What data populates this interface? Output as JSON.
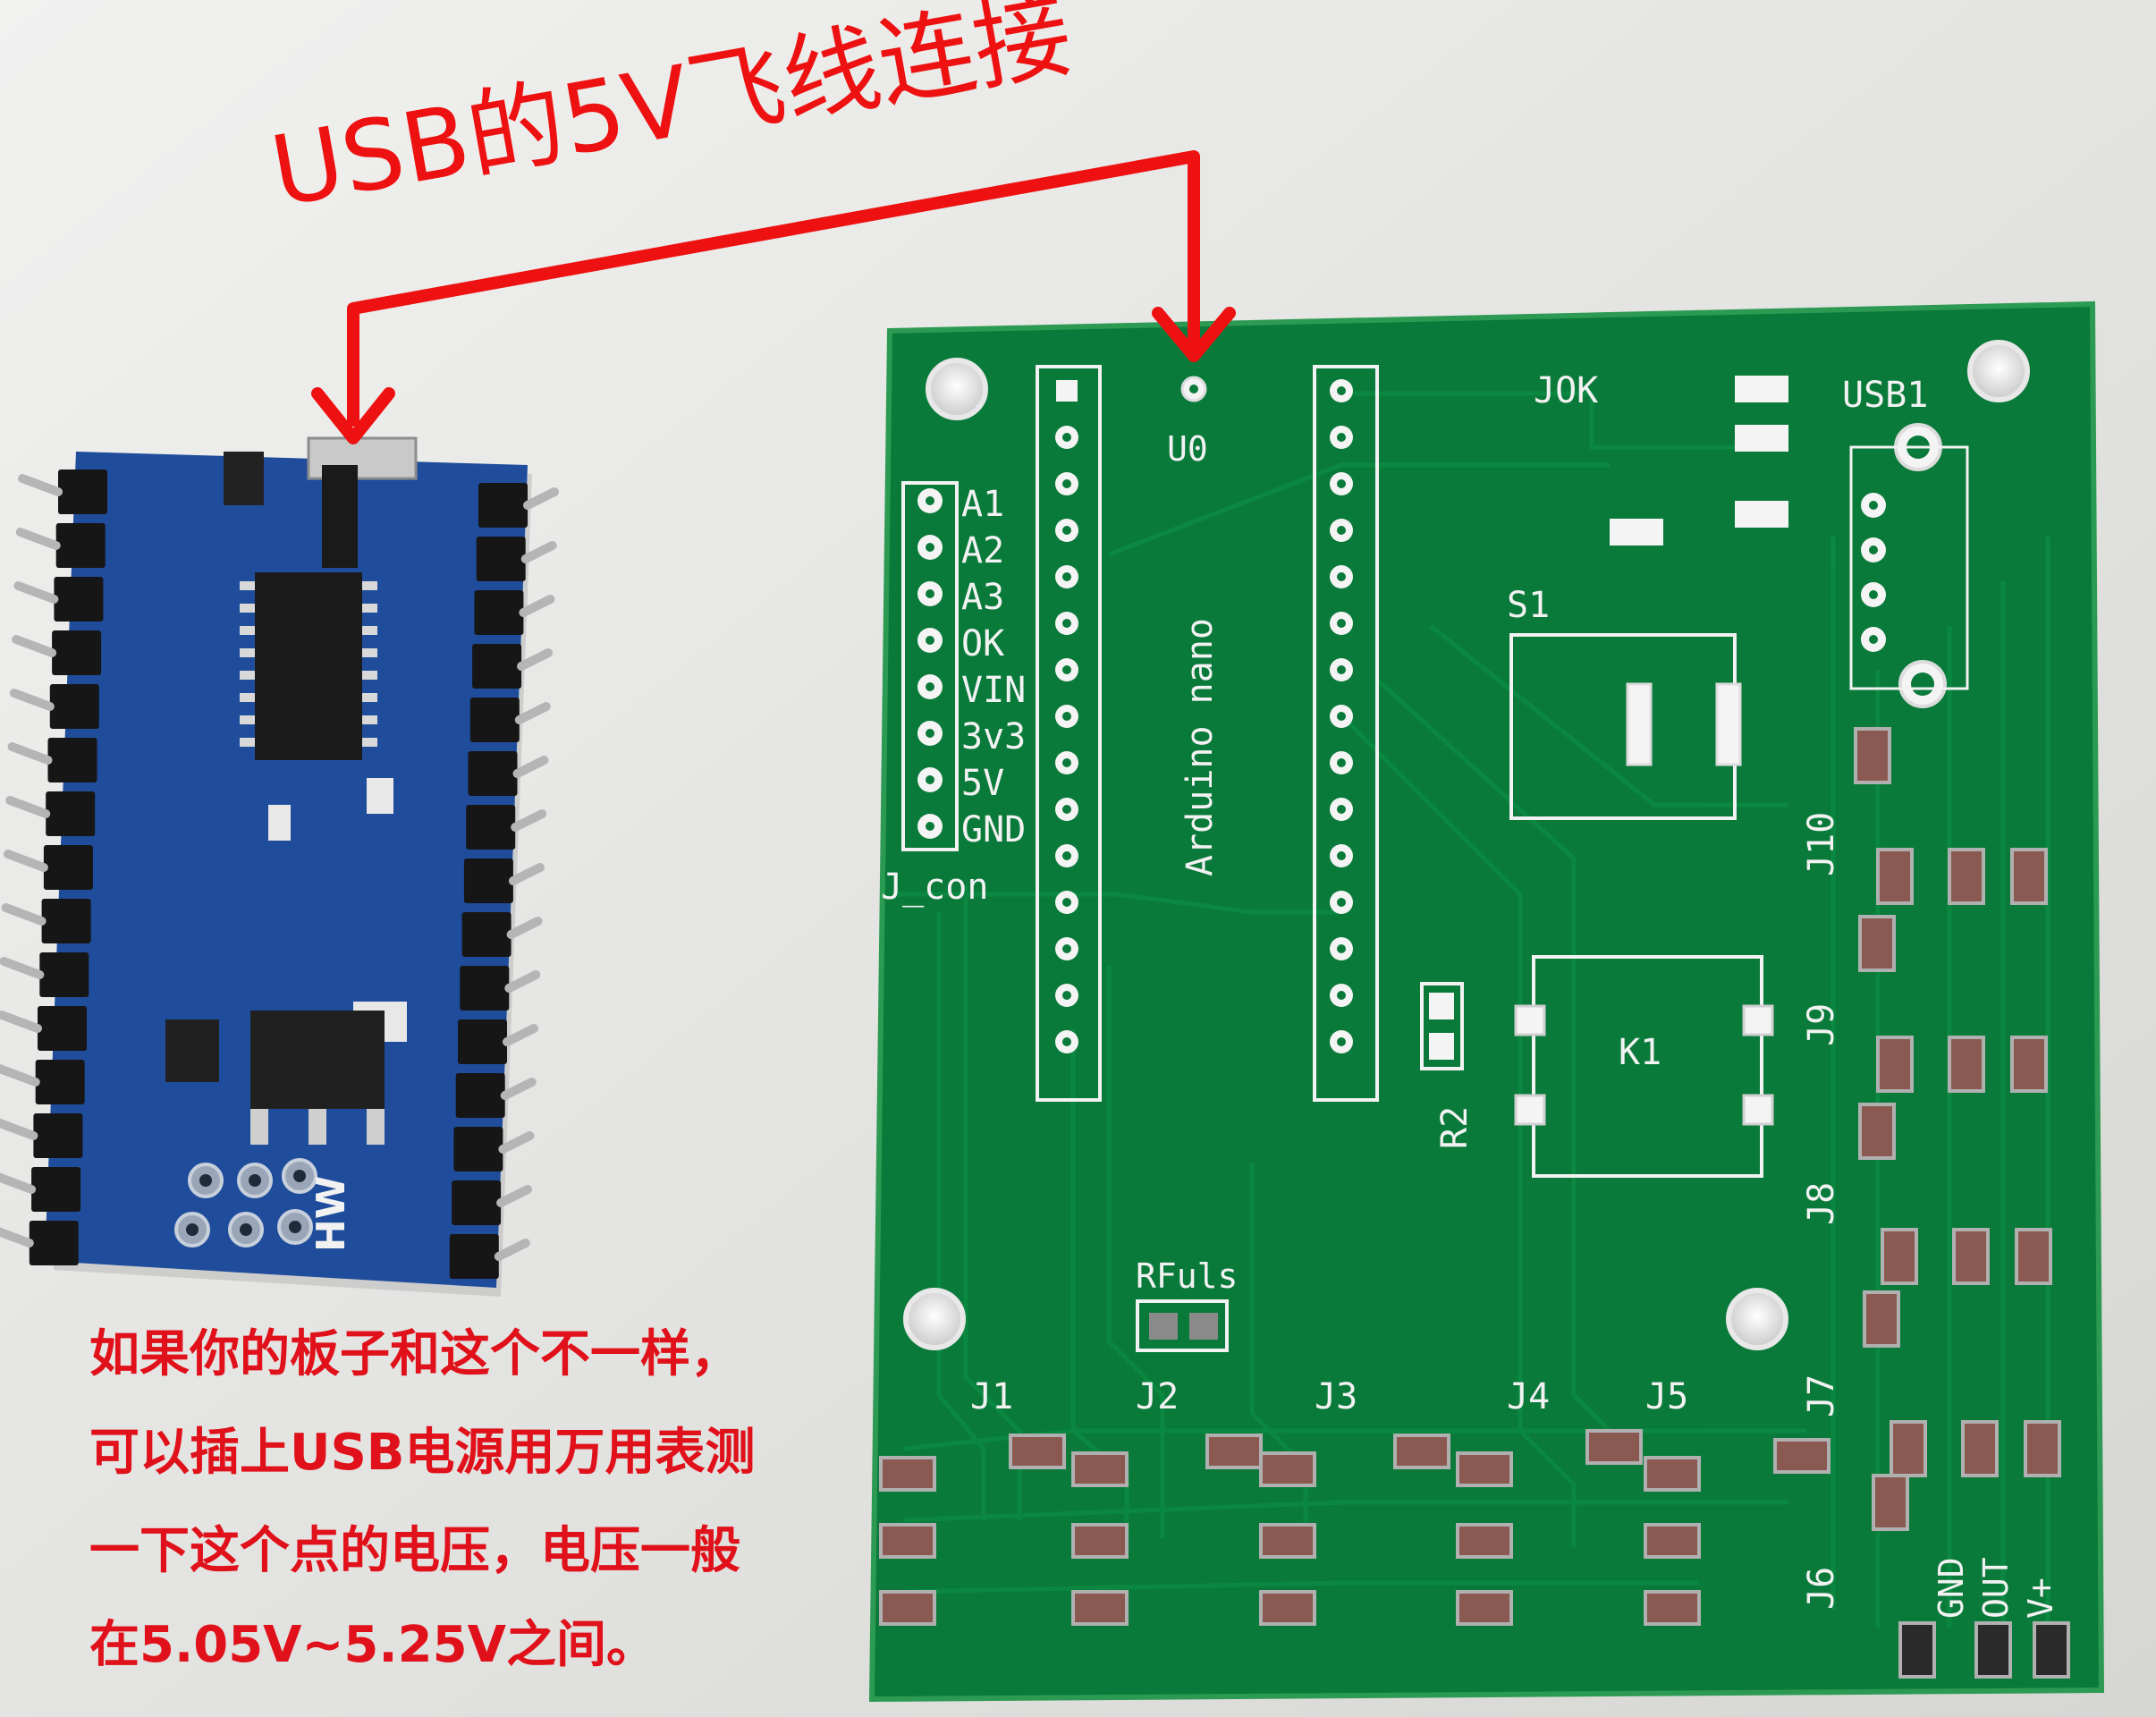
{
  "annotation": {
    "headline": "USB的5V飞线连接",
    "arrow_color": "#ee1111",
    "note_lines": [
      "如果你的板子和这个不一样，",
      "可以插上USB电源用万用表测",
      "一下这个点的电压，电压一般",
      "在5.05V~5.25V之间。"
    ],
    "note_color": "#e0111a"
  },
  "arduino_nano": {
    "board_color": "#1f4d9c",
    "silkscreen": "HW"
  },
  "pcb": {
    "board_color": "#0a7a3a",
    "silk_color": "#f2f2f2",
    "labels": {
      "u0": "U0",
      "jok": "JOK",
      "usb1": "USB1",
      "arduino_nano": "Arduino nano",
      "s1": "S1",
      "k1": "K1",
      "r2": "R2",
      "rfuls": "RFuls",
      "j_con": "J_con"
    },
    "header_pins": [
      "A1",
      "A2",
      "A3",
      "OK",
      "VIN",
      "3v3",
      "5V",
      "GND"
    ],
    "connectors_bottom": [
      "J1",
      "J2",
      "J3",
      "J4",
      "J5"
    ],
    "connectors_side": [
      "J10",
      "J9",
      "J8",
      "J7",
      "J6"
    ],
    "power_labels": [
      "GND",
      "OUT",
      "V+"
    ]
  }
}
